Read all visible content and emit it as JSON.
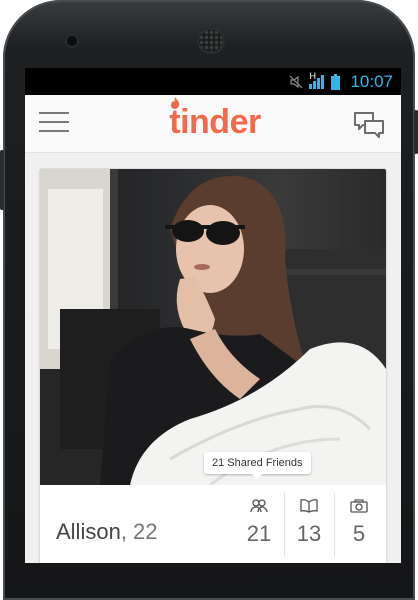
{
  "status_bar": {
    "time": "10:07",
    "network_label": "H"
  },
  "app_bar": {
    "logo_text": "tinder"
  },
  "card": {
    "shared_friends_label": "21 Shared Friends",
    "name": "Allison",
    "age_text": ", 22",
    "stats": [
      {
        "icon": "friends-icon",
        "value": "21"
      },
      {
        "icon": "book-icon",
        "value": "13"
      },
      {
        "icon": "camera-icon",
        "value": "5"
      }
    ]
  },
  "colors": {
    "brand": "#f26a4b",
    "status_accent": "#33b5e5"
  }
}
